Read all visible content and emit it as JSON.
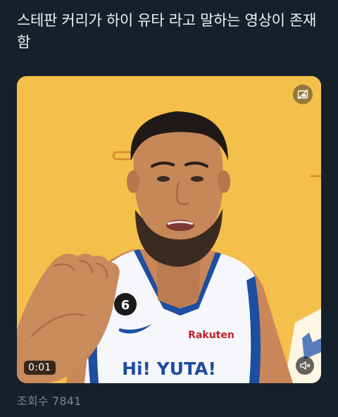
{
  "post": {
    "text": "스테판 커리가 하이 유타 라고 말하는 영상이 존재함"
  },
  "video": {
    "time": "0:01",
    "jersey_text": "Hi! YUTA!",
    "sponsor_text": "Rakuten",
    "jersey_number": "6",
    "pip_icon": "picture-in-picture-off-icon",
    "mute_icon": "volume-muted-icon"
  },
  "stats": {
    "views": "조회수 7841"
  },
  "colors": {
    "background": "#16202b",
    "video_backdrop": "#f3bd48",
    "jersey_blue": "#1d4ea1",
    "muted_text": "#7b8792"
  }
}
